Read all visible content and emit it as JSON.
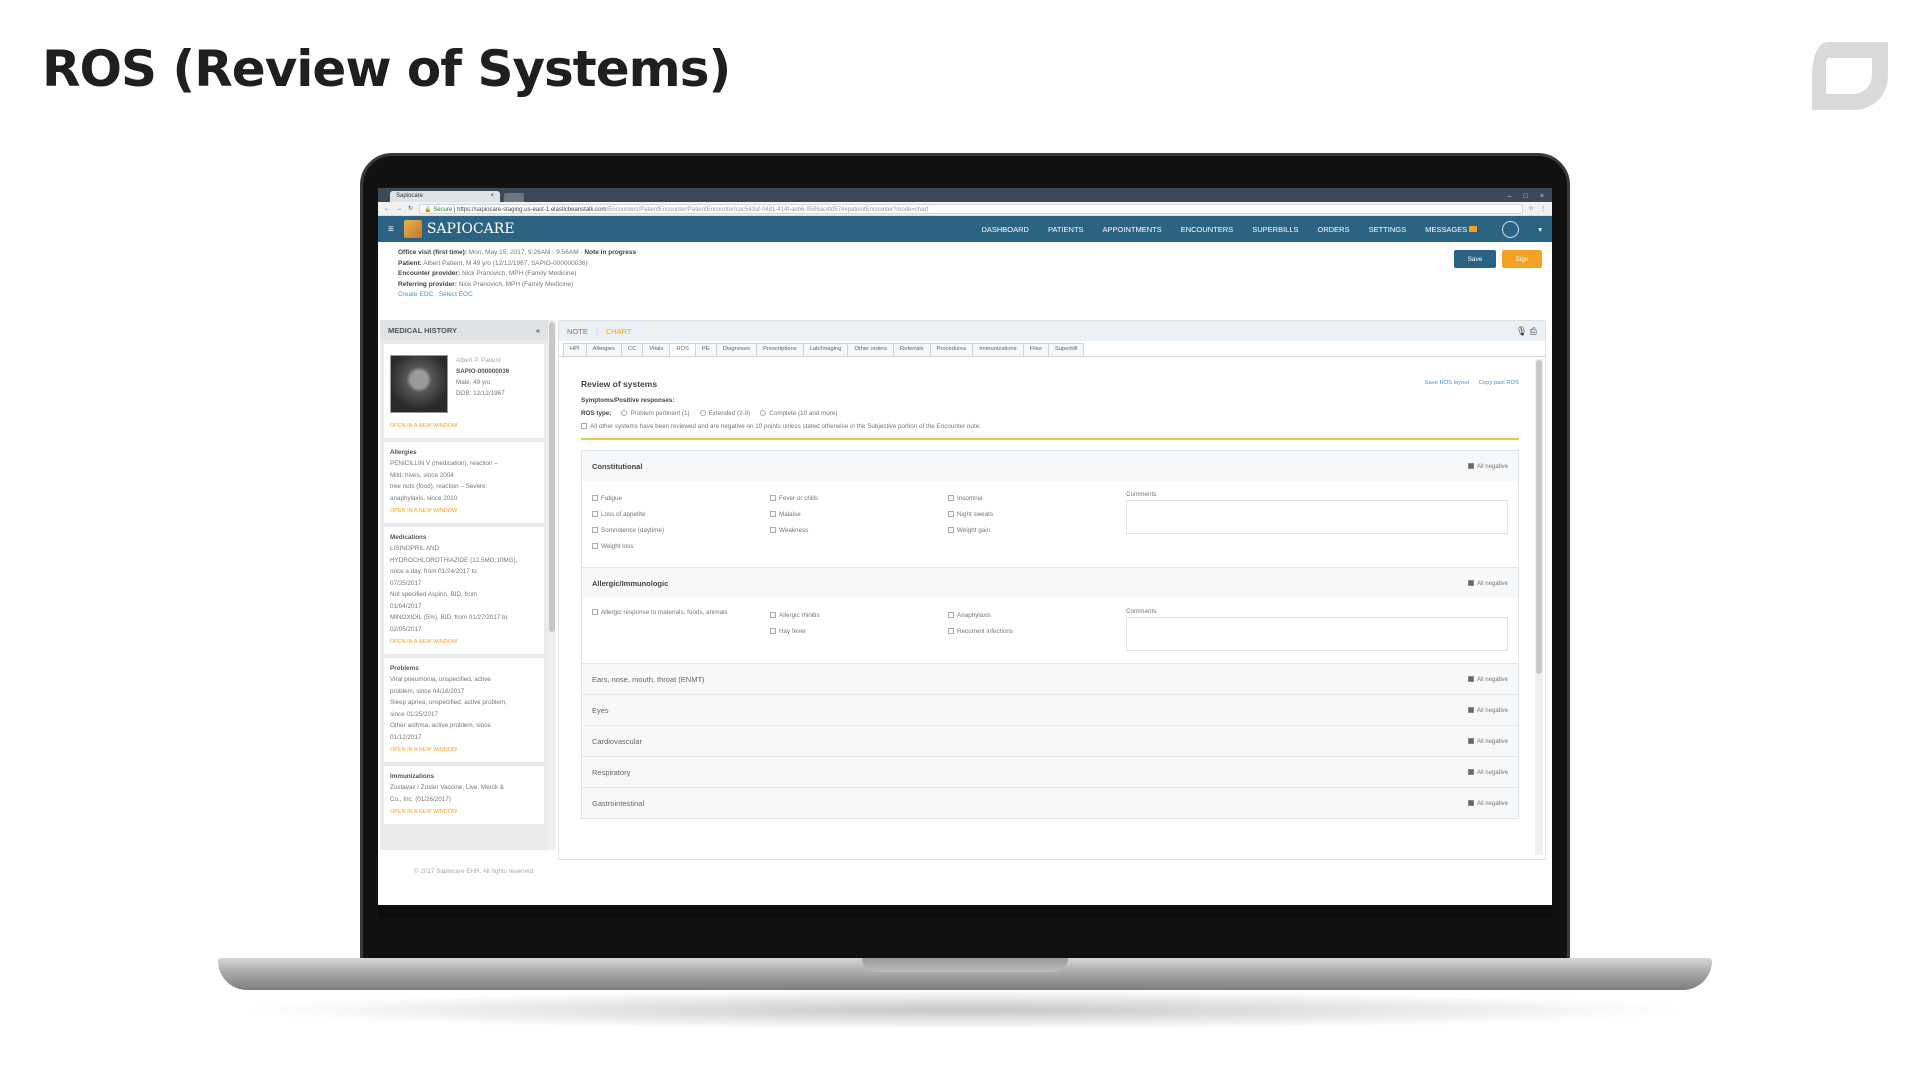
{
  "slide": {
    "title": "ROS (Review of Systems)",
    "accent": "#f3a322",
    "brand_blue": "#2b6483"
  },
  "browser": {
    "tab_title": "Sapiocare",
    "secure_label": "Secure",
    "url_host": "https://sapiocare-staging.us-east-1.elasticbeanstalk.com",
    "url_path": "/Encounters/PatientEncounter/PatientEncounter/cac543af-0481-414f-aeb6-9586ac4fd574#patientEncounter?mode=chart"
  },
  "nav": {
    "brand": "SAPIOCARE",
    "links": [
      "DASHBOARD",
      "PATIENTS",
      "APPOINTMENTS",
      "ENCOUNTERS",
      "SUPERBILLS",
      "ORDERS",
      "SETTINGS",
      "MESSAGES"
    ]
  },
  "encounter": {
    "visit_label": "Office visit (first time):",
    "visit_value": "Mon, May 15, 2017, 9:26AM - 9:56AM",
    "visit_status": "Note in progress",
    "patient_label": "Patient:",
    "patient_value": "Albert Patient, M 49 y/o (12/12/1967, SAPIO-000000036)",
    "provider_label": "Encounter provider:",
    "provider_value": "Nick Pranovich, MPH (Family Medicine)",
    "referring_label": "Referring provider:",
    "referring_value": "Nick Pranovich, MPH (Family Medicine)",
    "link_create": "Create EOC",
    "link_select": "Select EOC",
    "save_label": "Save",
    "sign_label": "Sign"
  },
  "sidebar": {
    "title": "MEDICAL HISTORY",
    "collapse": "«",
    "patient": {
      "name": "Albert P. Patient",
      "mrn": "SAPIO-000000036",
      "sex_age": "Male, 49 y/o",
      "dob": "DOB: 12/12/1967",
      "open": "OPEN IN A NEW WINDOW"
    },
    "allergies": {
      "title": "Allergies",
      "lines": [
        "PENICILLIN V (medication), reaction –",
        "Mild: hives, since 2004",
        "tree nuts (food), reaction – Severe:",
        "anaphylaxis, since 2010"
      ],
      "open": "OPEN IN A NEW WINDOW"
    },
    "medications": {
      "title": "Medications",
      "lines": [
        "LISINOPRIL AND",
        "HYDROCHLOROTHIAZIDE (12.5MG;10MG),",
        "once a day, from 01/24/2017 to",
        "07/25/2017",
        "Not specified Aspirin, BID, from",
        "01/04/2017",
        "MINOXIDIL (5%), BID, from 01/27/2017 to",
        "02/05/2017"
      ],
      "open": "OPEN IN A NEW WINDOW"
    },
    "problems": {
      "title": "Problems",
      "lines": [
        "Viral pneumonia, unspecified, active",
        "problem, since 04/16/2017",
        "Sleep apnea, unspecified, active problem,",
        "since 01/25/2017",
        "Other asthma, active problem, since",
        "01/12/2017"
      ],
      "open": "OPEN IN A NEW WINDOW"
    },
    "immunizations": {
      "title": "Immunizations",
      "lines": [
        "Zostavax / Zoster Vaccine, Live, Merck &",
        "Co., Inc. (01/26/2017)"
      ],
      "open": "OPEN IN A NEW WINDOW"
    }
  },
  "main": {
    "note_tab": "NOTE",
    "chart_tab": "CHART",
    "section_tabs": [
      "HPI",
      "Allergies",
      "CC",
      "Vitals",
      "ROS",
      "PE",
      "Diagnoses",
      "Prescriptions",
      "Lab/Imaging",
      "Other orders",
      "Referrals",
      "Procedures",
      "Immunizations",
      "Files",
      "Superbill"
    ],
    "ros_title": "Review of systems",
    "save_layout": "Save ROS layout",
    "copy_past": "Copy past ROS",
    "symptoms_label": "Symptoms/Positive responses:",
    "ros_type_label": "ROS type:",
    "ros_types": [
      "Problem pertinent (1)",
      "Extended (2-9)",
      "Complete (10 and more)"
    ],
    "all_other_note": "All other systems have been reviewed and are negative on 10 points unless stated otherwise in the Subjective portion of the Encounter note.",
    "all_negative": "All negative",
    "comments": "Comments",
    "constitutional": {
      "title": "Constitutional",
      "col1": [
        "Fatigue",
        "Loss of appetite",
        "Somnolence (daytime)",
        "Weight loss"
      ],
      "col2": [
        "Fever or chills",
        "Malaise",
        "Weakness"
      ],
      "col3": [
        "Insomnia",
        "Night sweats",
        "Weight gain"
      ]
    },
    "allergic": {
      "title": "Allergic/Immunologic",
      "col1": [
        "Allergic response to materials, foods, animals"
      ],
      "col2": [
        "Allergic rhinitis",
        "Hay fever"
      ],
      "col3": [
        "Anaphylaxis",
        "Recurrent infections"
      ]
    },
    "collapsed": [
      "Ears, nose, mouth, throat (ENMT)",
      "Eyes",
      "Cardiovascular",
      "Respiratory",
      "Gastrointestinal"
    ]
  },
  "footer": {
    "copyright": "© 2017 Sapiocare EHR. All rights reserved."
  }
}
